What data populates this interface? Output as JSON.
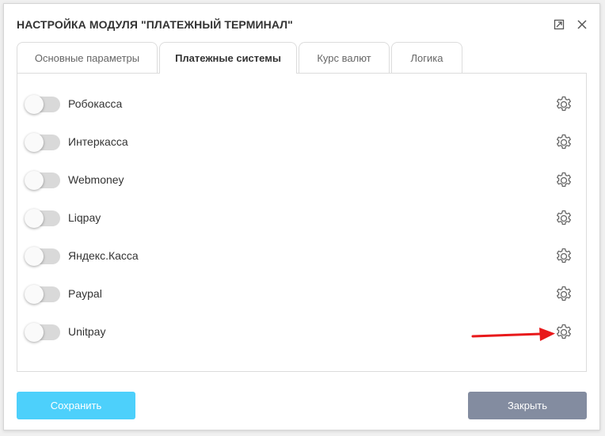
{
  "dialog": {
    "title": "НАСТРОЙКА МОДУЛЯ \"ПЛАТЕЖНЫЙ ТЕРМИНАЛ\""
  },
  "tabs": [
    {
      "label": "Основные параметры",
      "active": false
    },
    {
      "label": "Платежные системы",
      "active": true
    },
    {
      "label": "Курс валют",
      "active": false
    },
    {
      "label": "Логика",
      "active": false
    }
  ],
  "payment_systems": [
    {
      "label": "Робокасса",
      "enabled": false
    },
    {
      "label": "Интеркасса",
      "enabled": false
    },
    {
      "label": "Webmoney",
      "enabled": false
    },
    {
      "label": "Liqpay",
      "enabled": false
    },
    {
      "label": "Яндекс.Касса",
      "enabled": false
    },
    {
      "label": "Paypal",
      "enabled": false
    },
    {
      "label": "Unitpay",
      "enabled": false
    }
  ],
  "buttons": {
    "save_label": "Сохранить",
    "close_label": "Закрыть"
  },
  "colors": {
    "save_button": "#4dd0fb",
    "close_button": "#838ca0",
    "toggle_off": "#d9d9d9",
    "arrow": "#e8191b"
  },
  "icons": {
    "window": [
      "maximize-icon",
      "close-icon"
    ],
    "row_action": "gear-icon",
    "annotation": "red-arrow"
  }
}
